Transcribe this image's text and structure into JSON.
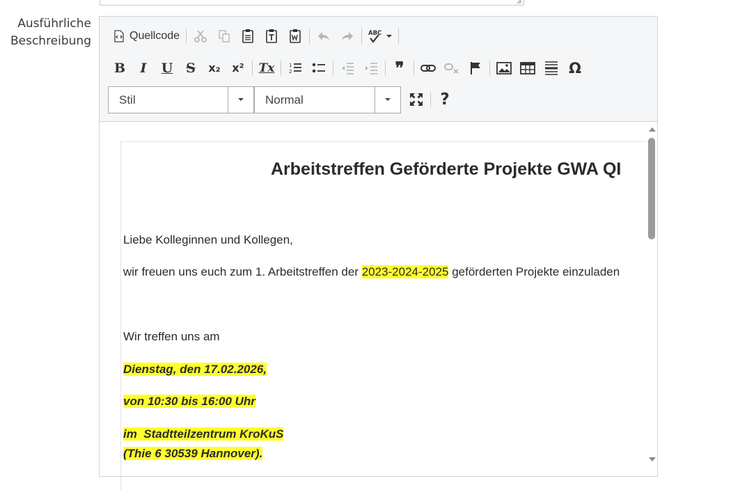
{
  "form": {
    "label_line1": "Ausführliche",
    "label_line2": "Beschreibung"
  },
  "toolbar": {
    "source_label": "Quellcode",
    "style_combo": "Stil",
    "format_combo": "Normal",
    "help_label": "?",
    "icons_row1": [
      "source-icon",
      "cut-icon",
      "copy-icon",
      "paste-icon",
      "paste-text-icon",
      "paste-word-icon",
      "undo-icon",
      "redo-icon",
      "spellcheck-icon"
    ],
    "icons_row2": [
      "bold-icon",
      "italic-icon",
      "underline-icon",
      "strike-icon",
      "subscript-icon",
      "superscript-icon",
      "remove-format-icon",
      "numbered-list-icon",
      "bulleted-list-icon",
      "outdent-icon",
      "indent-icon",
      "blockquote-icon",
      "link-icon",
      "unlink-icon",
      "anchor-icon",
      "image-icon",
      "table-icon",
      "horizontal-rule-icon",
      "special-char-icon"
    ],
    "icons_row3": [
      "maximize-icon",
      "help-icon"
    ],
    "glyphs": {
      "bold": "B",
      "italic": "I",
      "underline": "U",
      "strike": "S",
      "subscript": "x₂",
      "superscript": "x²",
      "remove_format": "Tx",
      "blockquote": "❞",
      "special_char": "Ω",
      "spellcheck": "ABC"
    }
  },
  "document": {
    "title": "Arbeitstreffen Geförderte Projekte GWA QI",
    "greeting": "Liebe Kolleginnen und Kollegen,",
    "invite_before": "wir freuen uns euch zum 1. Arbeitstreffen der ",
    "invite_highlight": "2023-2024-2025",
    "invite_after": " geförderten Projekte einzuladen",
    "meet_intro": "Wir treffen uns am",
    "date": "Dienstag, den 17.02.2026,",
    "time": "von 10:30 bis 16:00 Uhr",
    "place": "im  Stadtteilzentrum KroKuS",
    "address": "(Thie 6 30539 Hannover)."
  },
  "colors": {
    "highlight": "#ffff2c",
    "toolbar_bg": "#f5f6f7",
    "text": "#2b2b2b"
  }
}
